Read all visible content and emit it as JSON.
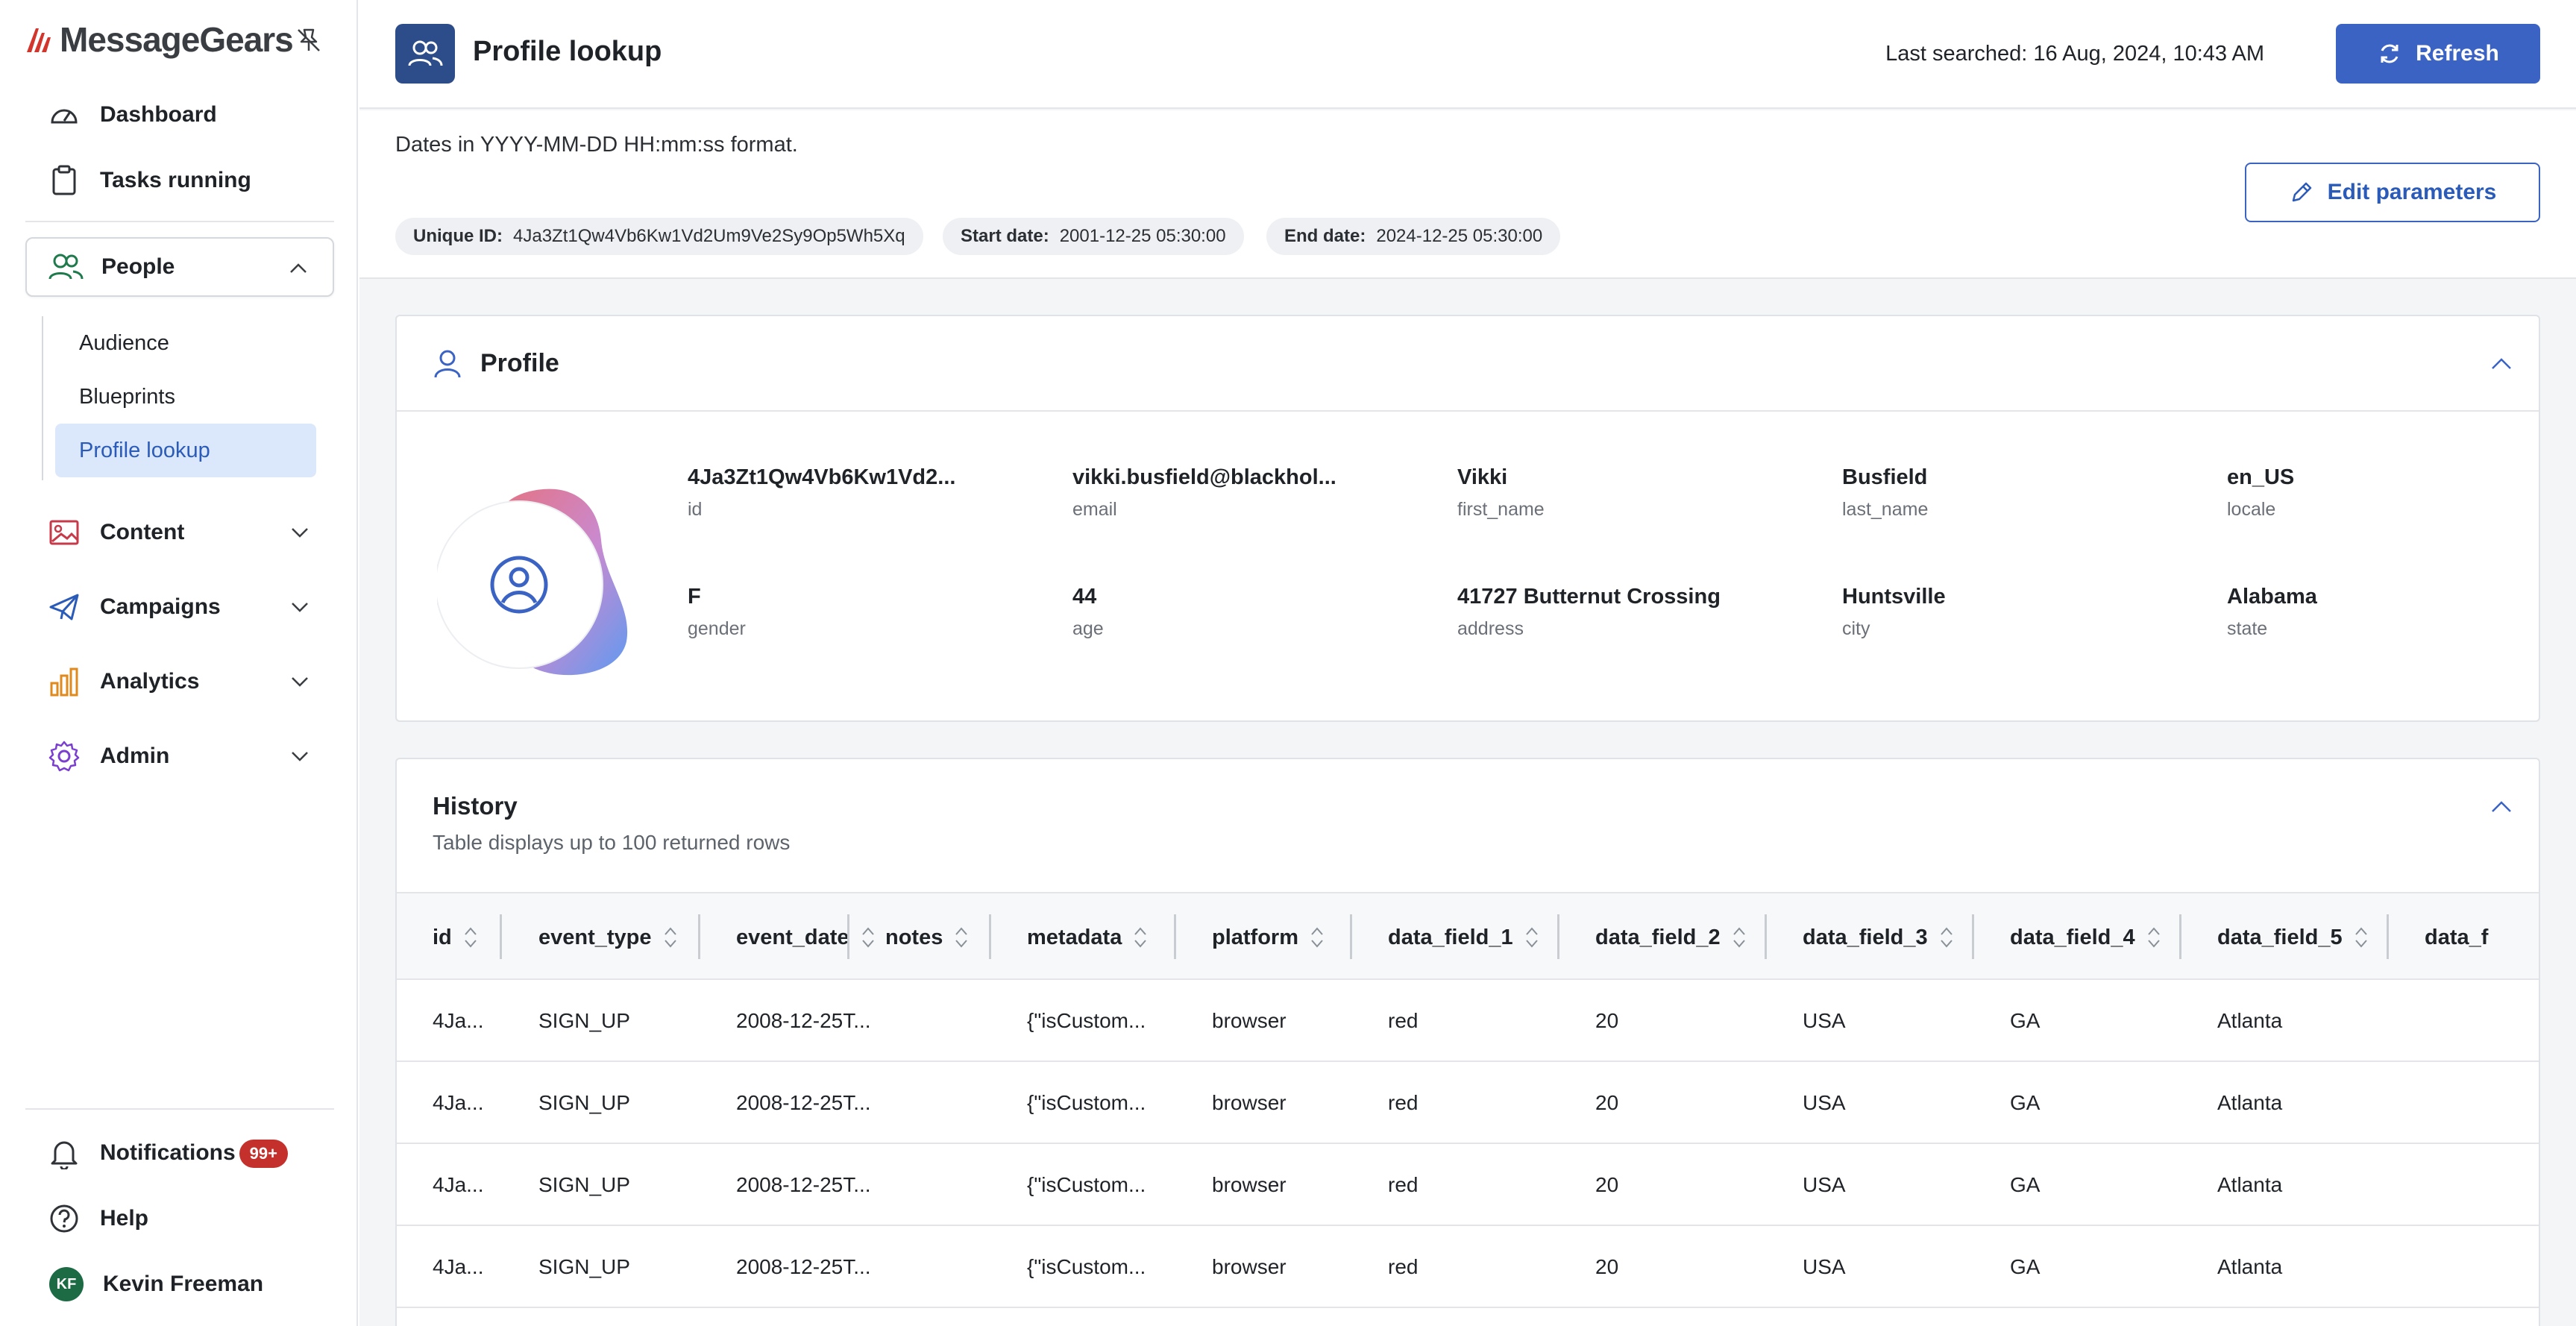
{
  "app": {
    "logo_text": "MessageGears"
  },
  "sidebar": {
    "dashboard": "Dashboard",
    "tasks": "Tasks running",
    "people": "People",
    "people_sub": [
      "Audience",
      "Blueprints",
      "Profile lookup"
    ],
    "content": "Content",
    "campaigns": "Campaigns",
    "analytics": "Analytics",
    "admin": "Admin",
    "notifications": "Notifications",
    "notifications_badge": "99+",
    "help": "Help",
    "user_initials": "KF",
    "user_name": "Kevin Freeman"
  },
  "header": {
    "title": "Profile lookup",
    "last_searched": "Last searched: 16 Aug, 2024, 10:43 AM",
    "refresh_label": "Refresh"
  },
  "params": {
    "dates_note": "Dates in YYYY-MM-DD HH:mm:ss format.",
    "edit_label": "Edit parameters",
    "unique_id_label": "Unique ID:",
    "unique_id_value": "4Ja3Zt1Qw4Vb6Kw1Vd2Um9Ve2Sy9Op5Wh5Xq",
    "start_label": "Start date:",
    "start_value": "2001-12-25 05:30:00",
    "end_label": "End date:",
    "end_value": "2024-12-25 05:30:00"
  },
  "profile": {
    "title": "Profile",
    "fields": [
      {
        "value": "4Ja3Zt1Qw4Vb6Kw1Vd2...",
        "key": "id"
      },
      {
        "value": "vikki.busfield@blackhol...",
        "key": "email"
      },
      {
        "value": "Vikki",
        "key": "first_name"
      },
      {
        "value": "Busfield",
        "key": "last_name"
      },
      {
        "value": "en_US",
        "key": "locale"
      },
      {
        "value": "F",
        "key": "gender"
      },
      {
        "value": "44",
        "key": "age"
      },
      {
        "value": "41727 Butternut Crossing",
        "key": "address"
      },
      {
        "value": "Huntsville",
        "key": "city"
      },
      {
        "value": "Alabama",
        "key": "state"
      }
    ]
  },
  "history": {
    "title": "History",
    "subtitle": "Table displays up to 100 returned rows",
    "columns": [
      "id",
      "event_type",
      "event_date",
      "notes",
      "metadata",
      "platform",
      "data_field_1",
      "data_field_2",
      "data_field_3",
      "data_field_4",
      "data_field_5",
      "data_f"
    ],
    "rows": [
      [
        "4Ja...",
        "SIGN_UP",
        "2008-12-25T...",
        "",
        "{\"isCustom...",
        "browser",
        "red",
        "20",
        "USA",
        "GA",
        "Atlanta",
        ""
      ],
      [
        "4Ja...",
        "SIGN_UP",
        "2008-12-25T...",
        "",
        "{\"isCustom...",
        "browser",
        "red",
        "20",
        "USA",
        "GA",
        "Atlanta",
        ""
      ],
      [
        "4Ja...",
        "SIGN_UP",
        "2008-12-25T...",
        "",
        "{\"isCustom...",
        "browser",
        "red",
        "20",
        "USA",
        "GA",
        "Atlanta",
        ""
      ],
      [
        "4Ja...",
        "SIGN_UP",
        "2008-12-25T...",
        "",
        "{\"isCustom...",
        "browser",
        "red",
        "20",
        "USA",
        "GA",
        "Atlanta",
        ""
      ]
    ]
  },
  "colors": {
    "accent": "#3a63c4",
    "badge": "#c4302b",
    "active_bg": "#dbe8fb"
  }
}
